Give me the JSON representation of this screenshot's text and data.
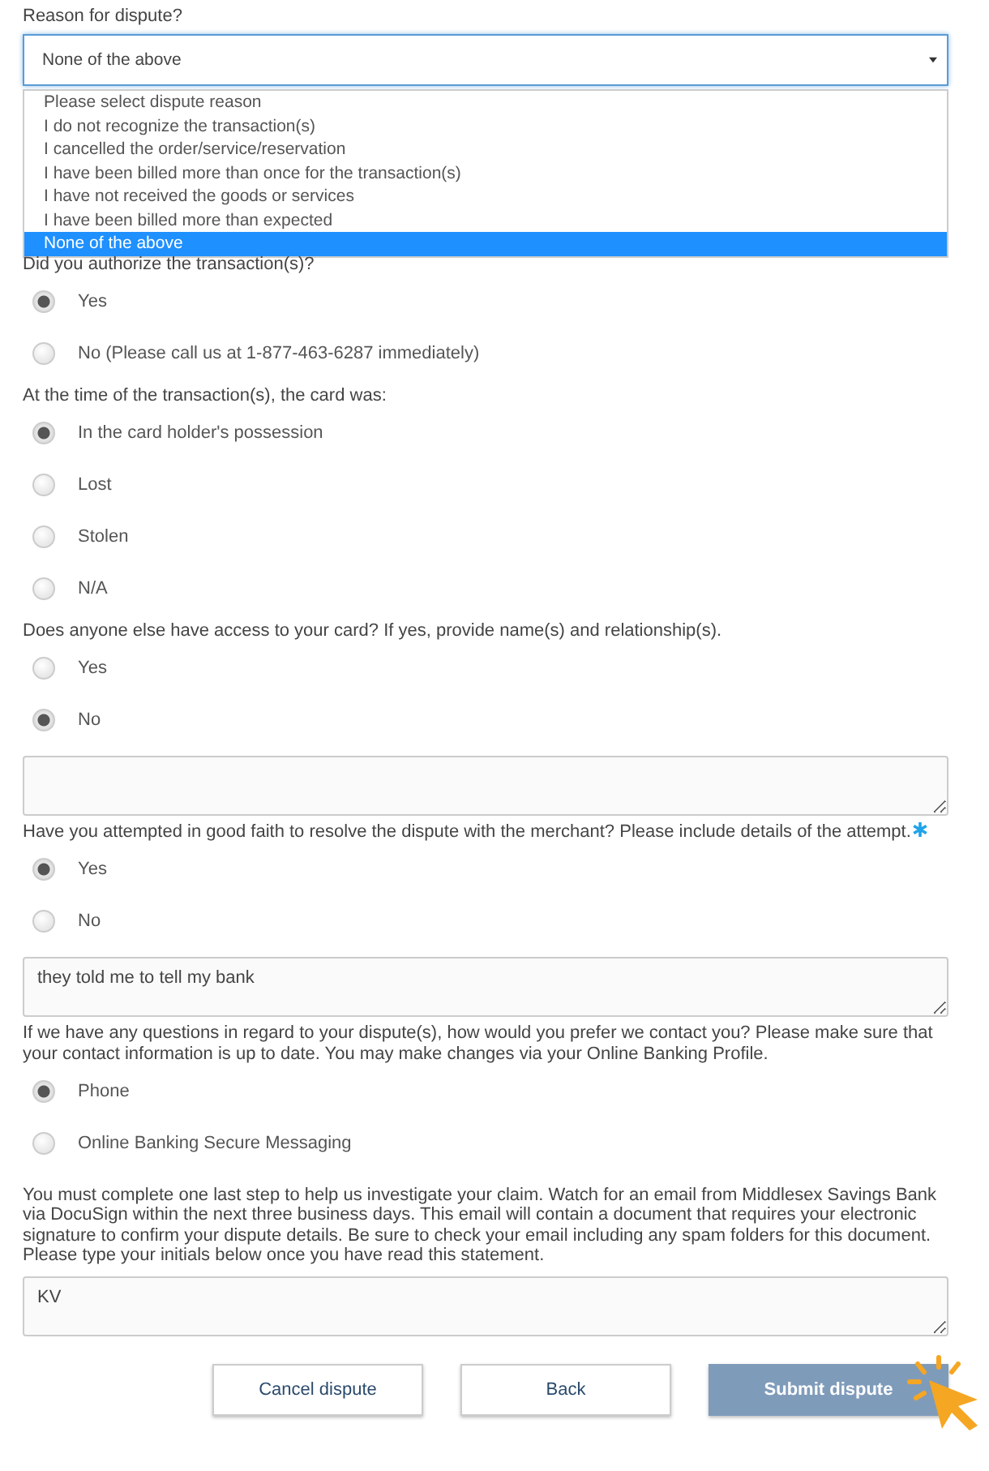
{
  "reason": {
    "label": "Reason for dispute?",
    "value": "None of the above",
    "options": [
      {
        "label": "Please select dispute reason",
        "selected": false
      },
      {
        "label": "I do not recognize the transaction(s)",
        "selected": false
      },
      {
        "label": "I cancelled the order/service/reservation",
        "selected": false
      },
      {
        "label": "I have been billed more than once for the transaction(s)",
        "selected": false
      },
      {
        "label": "I have not received the goods or services",
        "selected": false
      },
      {
        "label": "I have been billed more than expected",
        "selected": false
      },
      {
        "label": "None of the above",
        "selected": true
      }
    ]
  },
  "questions": [
    {
      "label": "Did you authorize the transaction(s)?",
      "required": false,
      "options": [
        {
          "label": "Yes",
          "selected": true
        },
        {
          "label": "No (Please call us at 1-877-463-6287 immediately)",
          "selected": false
        }
      ]
    },
    {
      "label": "At the time of the transaction(s), the card was:",
      "required": false,
      "options": [
        {
          "label": "In the card holder's possession",
          "selected": true
        },
        {
          "label": "Lost",
          "selected": false
        },
        {
          "label": "Stolen",
          "selected": false
        },
        {
          "label": "N/A",
          "selected": false
        }
      ]
    },
    {
      "label": "Does anyone else have access to your card? If yes, provide name(s) and relationship(s).",
      "required": false,
      "options": [
        {
          "label": "Yes",
          "selected": false
        },
        {
          "label": "No",
          "selected": true
        }
      ],
      "details": {
        "empty": true
      }
    },
    {
      "label": "Have you attempted in good faith to resolve the dispute with the merchant? Please include details of the attempt.",
      "required": true,
      "options": [
        {
          "label": "Yes",
          "selected": true
        },
        {
          "label": "No",
          "selected": false
        }
      ],
      "details": {
        "value": "they told me to tell my bank"
      }
    },
    {
      "label": "If we have any questions in regard to your dispute(s), how would you prefer we contact you? Please make sure that your contact information is up to date. You may make changes via your Online Banking Profile.",
      "required": false,
      "options": [
        {
          "label": "Phone",
          "selected": true
        },
        {
          "label": "Online Banking Secure Messaging",
          "selected": false
        }
      ]
    }
  ],
  "notice": "You must complete one last step to help us investigate your claim. Watch for an email from Middlesex Savings Bank via DocuSign within the next three business days. This email will contain a document that requires your electronic signature to confirm your dispute details. Be sure to check your email including any spam folders for this document. Please type your initials below once you have read this statement.",
  "initials": {
    "value": "KV"
  },
  "buttons": [
    {
      "label": "Cancel dispute",
      "kind": "secondary"
    },
    {
      "label": "Back",
      "kind": "secondary"
    },
    {
      "label": "Submit dispute",
      "kind": "primary"
    }
  ]
}
